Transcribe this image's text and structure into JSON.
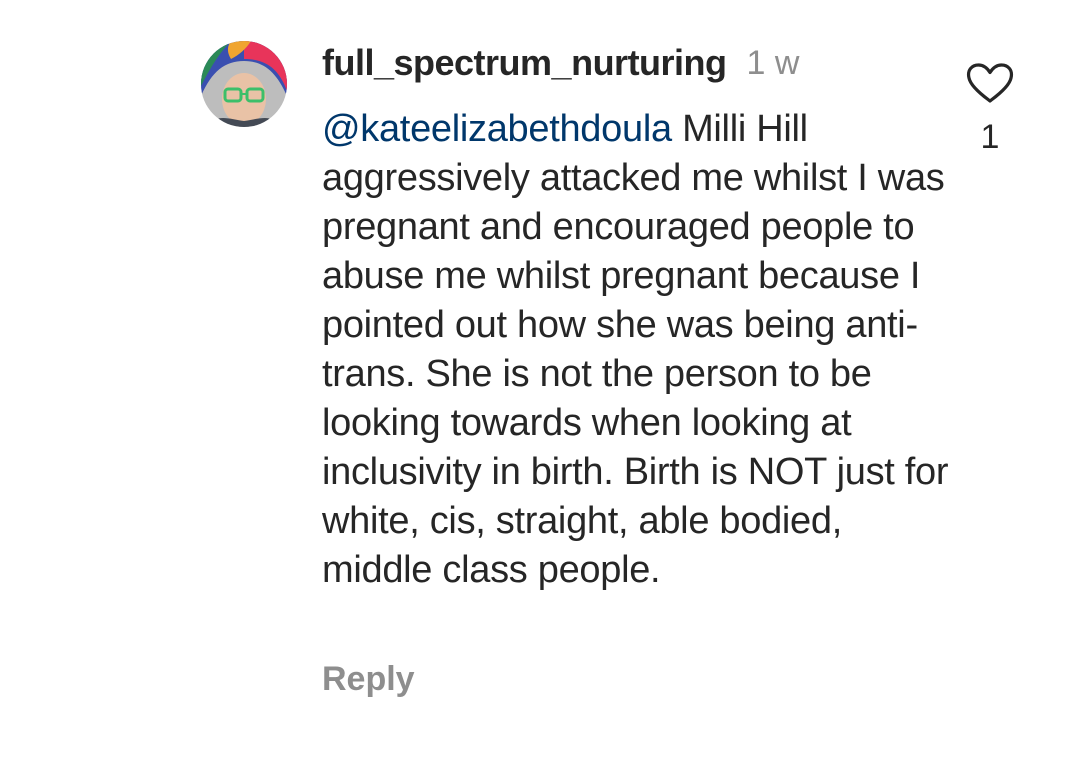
{
  "comment": {
    "username": "full_spectrum_nurturing",
    "time": "1 w",
    "mention": "@kateelizabethdoula",
    "text": "Milli Hill aggressively attacked me whilst I was pregnant and encouraged people to abuse me whilst pregnant because I pointed out how she was being anti-trans. She is not the person to be looking towards when looking at inclusivity in birth. Birth is NOT just for white, cis, straight, able bodied, middle class people.",
    "reply_label": "Reply",
    "like_count": "1",
    "like_icon": "heart-outline-icon"
  },
  "colors": {
    "text": "#262626",
    "secondary": "#8e8e8e",
    "mention": "#00376b"
  }
}
